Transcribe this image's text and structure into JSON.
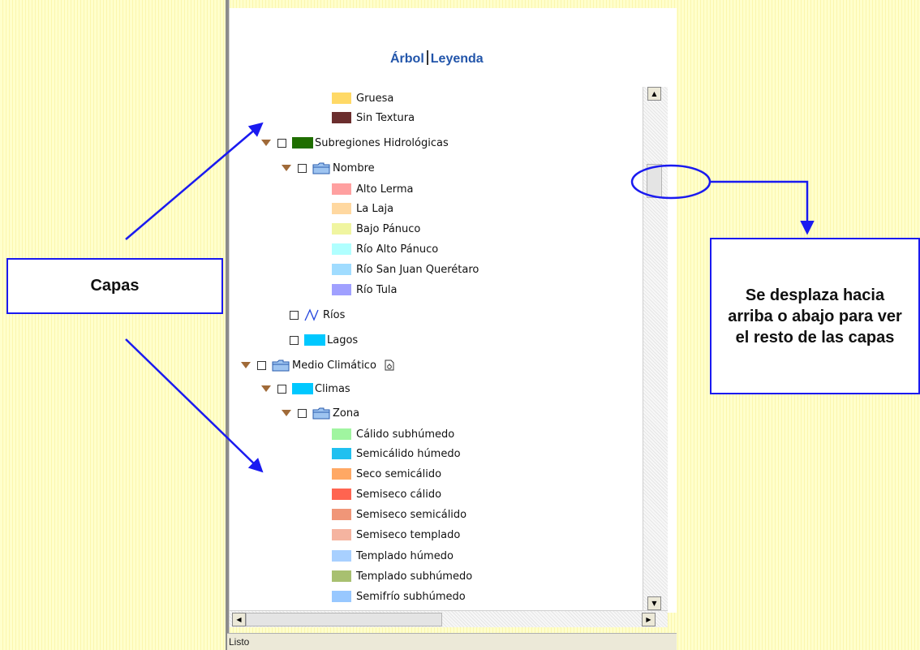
{
  "tabs": {
    "arbol": "Árbol",
    "leyenda": "Leyenda"
  },
  "tree": {
    "gruesa": "Gruesa",
    "sin_textura": "Sin Textura",
    "subregiones": "Subregiones Hidrológicas",
    "nombre": "Nombre",
    "alto_lerma": "Alto Lerma",
    "la_laja": "La Laja",
    "bajo_panuco": "Bajo Pánuco",
    "rio_alto_panuco": "Río Alto Pánuco",
    "rio_san_juan": "Río San Juan Querétaro",
    "rio_tula": "Río Tula",
    "rios": "Ríos",
    "lagos": "Lagos",
    "medio_climatico": "Medio Climático",
    "climas": "Climas",
    "zona": "Zona",
    "calido_subhumedo": "Cálido subhúmedo",
    "semicalido_humedo": "Semicálido húmedo",
    "seco_semicalido": "Seco semicálido",
    "semiseco_calido": "Semiseco cálido",
    "semiseco_semicalido": "Semiseco semicálido",
    "semiseco_templado": "Semiseco templado",
    "templado_humedo": "Templado húmedo",
    "templado_subhumedo": "Templado subhúmedo",
    "semifrio_subhumedo": "Semifrío subhúmedo"
  },
  "colors": {
    "gruesa": "#ffd966",
    "sin_textura": "#6b2e2e",
    "subregiones": "#1f6e00",
    "alto_lerma": "#ffa0a0",
    "la_laja": "#ffd8a0",
    "bajo_panuco": "#f0f5a0",
    "rio_alto_panuco": "#b0ffff",
    "rio_san_juan": "#a0dcff",
    "rio_tula": "#a0a0ff",
    "lagos": "#00c8ff",
    "climas": "#00c8ff",
    "calido_subhumedo": "#a0f5a0",
    "semicalido_humedo": "#20c0f0",
    "seco_semicalido": "#ffa864",
    "semiseco_calido": "#ff6450",
    "semiseco_semicalido": "#f09678",
    "semiseco_templado": "#f5b4a0",
    "templado_humedo": "#a8d0ff",
    "templado_subhumedo": "#a8c070",
    "semifrio_subhumedo": "#98c8ff",
    "callout_border": "#1a1af0"
  },
  "callouts": {
    "capas": "Capas",
    "desplaza": "Se desplaza hacia arriba o abajo para ver el resto de las capas"
  },
  "status": {
    "text": "Listo"
  }
}
